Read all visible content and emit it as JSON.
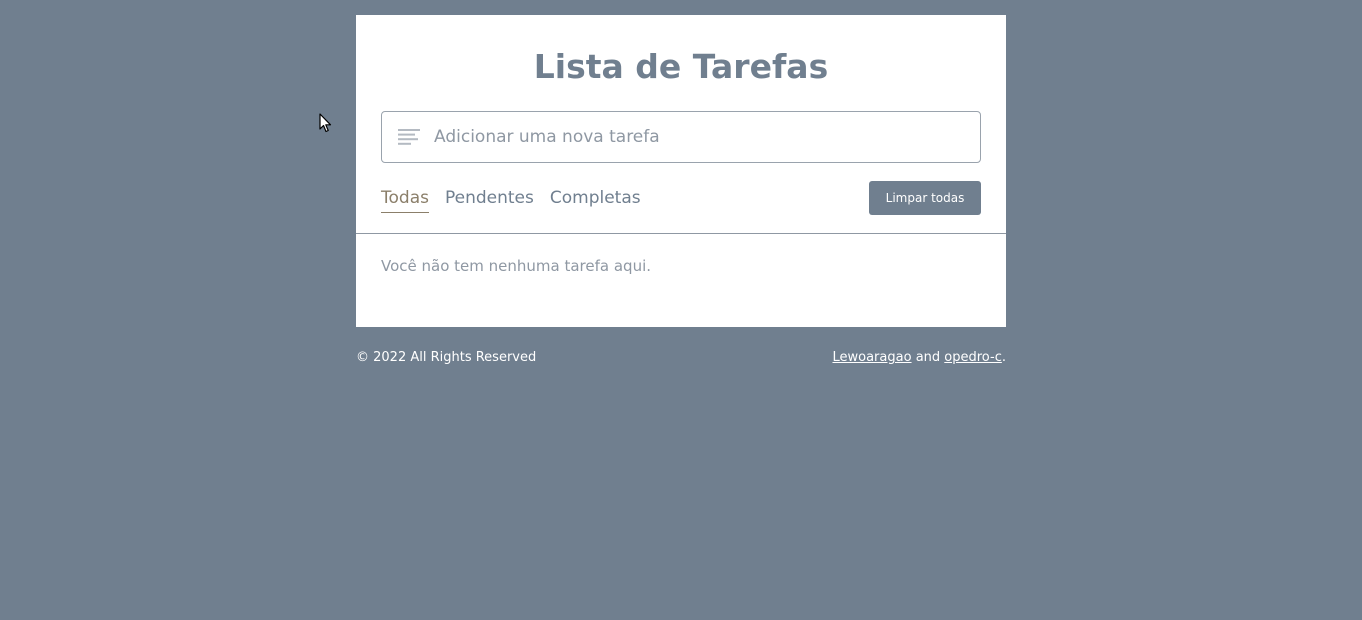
{
  "app": {
    "title": "Lista de Tarefas"
  },
  "input": {
    "value": "",
    "placeholder": "Adicionar uma nova tarefa",
    "icon": "align-left-icon"
  },
  "filters": {
    "items": [
      {
        "label": "Todas",
        "active": true
      },
      {
        "label": "Pendentes",
        "active": false
      },
      {
        "label": "Completas",
        "active": false
      }
    ]
  },
  "toolbar": {
    "clear_label": "Limpar todas"
  },
  "tasks": {
    "empty_message": "Você não tem nenhuma tarefa aqui."
  },
  "footer": {
    "copyright": "© 2022 All Rights Reserved",
    "author1": "Lewoaragao",
    "conjunction": "and",
    "author2": "opedro-c",
    "period": "."
  },
  "colors": {
    "background": "#707f8f",
    "card": "#ffffff",
    "accent": "#8b7f6a",
    "button": "#707f8f"
  }
}
